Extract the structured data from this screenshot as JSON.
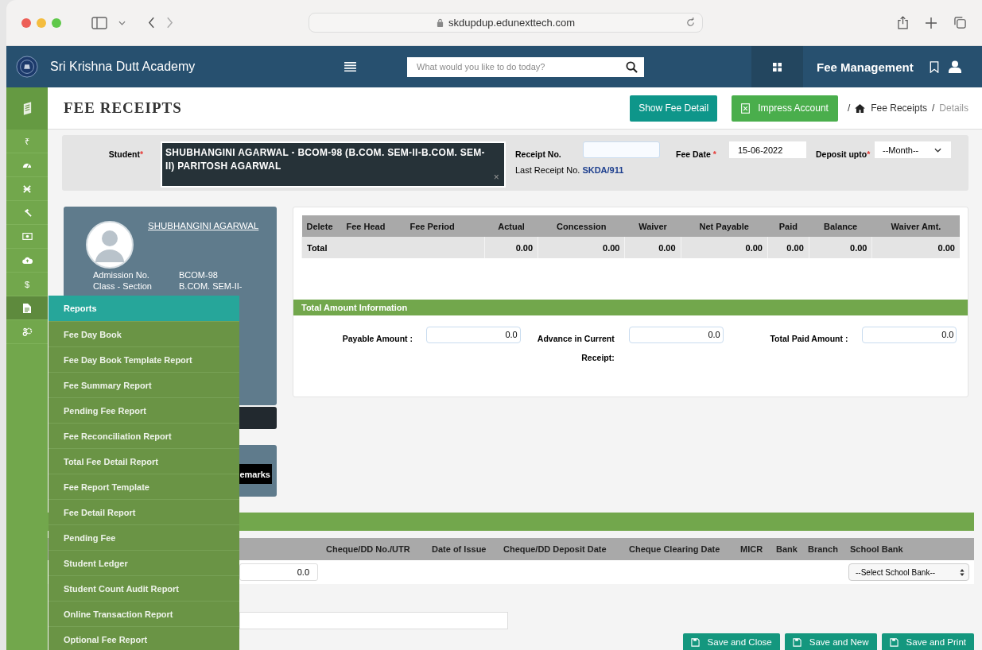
{
  "browser": {
    "url": "skdupdup.edunexttech.com"
  },
  "header": {
    "school_name": "Sri Krishna Dutt Academy",
    "search": {
      "placeholder": "What would you like to do today?"
    },
    "module": "Fee Management"
  },
  "sidebar": {
    "items": [
      {
        "kind": "glyph",
        "glyph": "₹",
        "selected": false
      },
      {
        "kind": "gauge",
        "selected": false
      },
      {
        "kind": "cross",
        "selected": false
      },
      {
        "kind": "gavel",
        "selected": false
      },
      {
        "kind": "money",
        "selected": false
      },
      {
        "kind": "cloud",
        "selected": false
      },
      {
        "kind": "glyph",
        "glyph": "$",
        "selected": false
      },
      {
        "kind": "file",
        "selected": true
      },
      {
        "kind": "gears",
        "selected": false
      }
    ]
  },
  "page": {
    "title": "FEE RECEIPTS",
    "buttons": [
      {
        "label": "Show Fee Detail",
        "kind": "teal"
      },
      {
        "label": "Impress Account",
        "kind": "excel"
      }
    ],
    "breadcrumb": [
      {
        "separator": "/",
        "label": "Fee Receipts",
        "home": true,
        "current": false
      },
      {
        "separator": "/",
        "label": "Details",
        "home": false,
        "current": true
      }
    ]
  },
  "student_panel": {
    "student_label": "Student",
    "student_required": "*",
    "student_value": "SHUBHANGINI AGARWAL - BCOM-98 (B.COM. SEM-II-B.COM. SEM-II) PARITOSH AGARWAL",
    "clear": "×",
    "receipt_label": "Receipt No.",
    "fee_date_label": "Fee Date",
    "fee_date_required": "*",
    "fee_date_value": "15-06-2022",
    "deposit_label": "Deposit upto",
    "deposit_required": "*",
    "deposit_value": "--Month--",
    "last_receipt_label": "Last Receipt No.",
    "last_receipt_value": "SKDA/911"
  },
  "profile": {
    "name": "SHUBHANGINI AGARWAL",
    "details": [
      {
        "label": "Admission No.",
        "value": "BCOM-98"
      },
      {
        "label": "Class - Section",
        "value": "B.COM. SEM-II-"
      }
    ],
    "remarks_button": "emarks"
  },
  "fee_table": {
    "columns": [
      "Delete",
      "Fee Head",
      "Fee Period",
      "Actual",
      "Concession",
      "Waiver",
      "Net Payable",
      "Paid",
      "Balance",
      "Waiver Amt."
    ],
    "total_row": {
      "label": "Total",
      "values": [
        "0.00",
        "0.00",
        "0.00",
        "0.00",
        "0.00",
        "0.00",
        "0.00"
      ]
    }
  },
  "total_info": {
    "title": "Total Amount Information",
    "fields": [
      {
        "label": "Payable Amount :",
        "value": "0.0"
      },
      {
        "label": "Advance in Current Receipt:",
        "value": "0.0"
      },
      {
        "label": "Total Paid Amount :",
        "value": "0.0"
      }
    ]
  },
  "payment": {
    "columns": [
      "Cheque/DD No./UTR",
      "Date of Issue",
      "Cheque/DD Deposit Date",
      "Cheque Clearing Date",
      "MICR",
      "Bank",
      "Branch",
      "School Bank"
    ],
    "amount_value": "0.0",
    "school_bank": "--Select School Bank--"
  },
  "actions": [
    "Save and Close",
    "Save and New",
    "Save and Print"
  ],
  "reports_menu": {
    "title": "Reports",
    "items": [
      "Fee Day Book",
      "Fee Day Book Template Report",
      "Fee Summary Report",
      "Pending Fee Report",
      "Fee Reconciliation Report",
      "Total Fee Detail Report",
      "Fee Report Template",
      "Fee Detail Report",
      "Pending Fee",
      "Student Ledger",
      "Student Count Audit Report",
      "Online Transaction Report",
      "Optional Fee Report"
    ]
  }
}
